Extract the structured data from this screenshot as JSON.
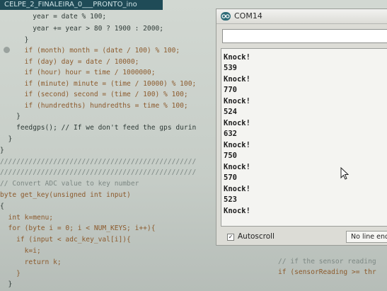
{
  "editor": {
    "tab_title": "CELPE_2_FINALEIRA_0___PRONTO_ino",
    "lines": [
      "        year = date % 100;",
      "        year += year > 80 ? 1900 : 2000;",
      "      }",
      "      if (month) month = (date / 100) % 100;",
      "      if (day) day = date / 10000;",
      "      if (hour) hour = time / 1000000;",
      "      if (minute) minute = (time / 10000) % 100;",
      "      if (second) second = (time / 100) % 100;",
      "      if (hundredths) hundredths = time % 100;",
      "    }",
      "    feedgps(); // If we don't feed the gps durin",
      "  }",
      "}",
      "////////////////////////////////////////////////",
      "////////////////////////////////////////////////",
      "// Convert ADC value to key number",
      "byte get_key(unsigned int input)",
      "{",
      "  int k=menu;",
      "  for (byte i = 0; i < NUM_KEYS; i++){",
      "    if (input < adc_key_val[i]){",
      "      k=i;",
      "      return k;",
      "    }",
      "  }"
    ],
    "fragment_lines": [
      "// if the sensor reading",
      "if (sensorReading >= thr"
    ]
  },
  "serial_monitor": {
    "title": "COM14",
    "send_input_value": "",
    "output_lines": [
      "Knock!",
      "539",
      "Knock!",
      "770",
      "Knock!",
      "524",
      "Knock!",
      "632",
      "Knock!",
      "750",
      "Knock!",
      "570",
      "Knock!",
      "523",
      "Knock!"
    ],
    "autoscroll_label": "Autoscroll",
    "autoscroll_checked": true,
    "checkmark": "✓",
    "line_ending_selected": "No line ending"
  },
  "colors": {
    "keyword": "#8c5a2c",
    "comment": "#7d8884",
    "titlebar_accent": "#1f4b57"
  }
}
